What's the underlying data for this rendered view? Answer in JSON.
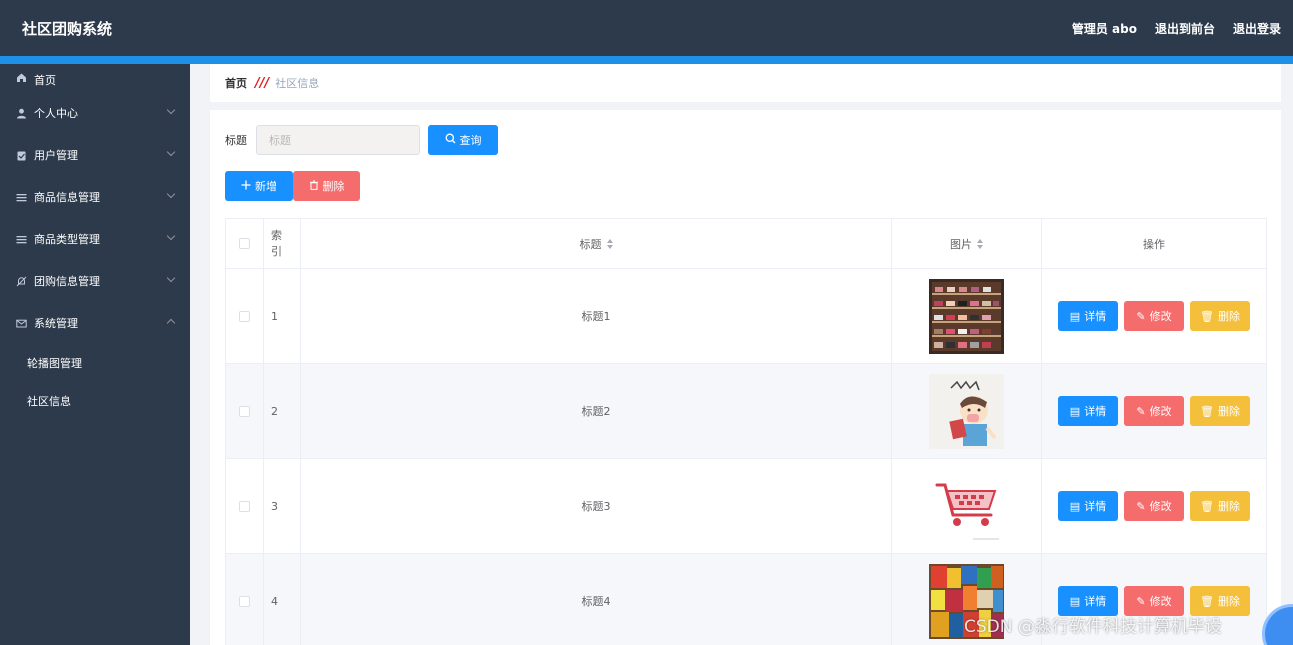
{
  "header": {
    "title": "社区团购系统",
    "nav": [
      "管理员 abo",
      "退出到前台",
      "退出登录"
    ]
  },
  "sidebar": {
    "items": [
      {
        "label": "首页",
        "icon": "home-icon"
      },
      {
        "label": "个人中心",
        "icon": "user-icon"
      },
      {
        "label": "用户管理",
        "icon": "clipboard-icon"
      },
      {
        "label": "商品信息管理",
        "icon": "list-icon"
      },
      {
        "label": "商品类型管理",
        "icon": "list-icon"
      },
      {
        "label": "团购信息管理",
        "icon": "bell-off-icon"
      },
      {
        "label": "系统管理",
        "icon": "mail-icon"
      }
    ],
    "subitems": [
      "轮播图管理",
      "社区信息"
    ]
  },
  "breadcrumb": {
    "home": "首页",
    "current": "社区信息"
  },
  "search": {
    "label": "标题",
    "placeholder": "标题",
    "button": "查询"
  },
  "actions": {
    "add": "新增",
    "delete": "删除"
  },
  "table": {
    "headers": {
      "index": "索引",
      "title": "标题",
      "image": "图片",
      "operation": "操作"
    },
    "rows": [
      {
        "index": "1",
        "title": "标题1",
        "image": "shoe-rack-photo"
      },
      {
        "index": "2",
        "title": "标题2",
        "image": "cartoon-shopper-image"
      },
      {
        "index": "3",
        "title": "标题3",
        "image": "shopping-cart-image"
      },
      {
        "index": "4",
        "title": "标题4",
        "image": "snacks-photo"
      }
    ],
    "row_buttons": {
      "detail": "详情",
      "edit": "修改",
      "delete": "删除"
    }
  },
  "watermark": "CSDN @淼行软件科技计算机毕设",
  "colors": {
    "header_bg": "#2d3a4b",
    "accent_blue": "#1890ff",
    "danger_red": "#f56c6c",
    "warning_yellow": "#f4c03c"
  }
}
